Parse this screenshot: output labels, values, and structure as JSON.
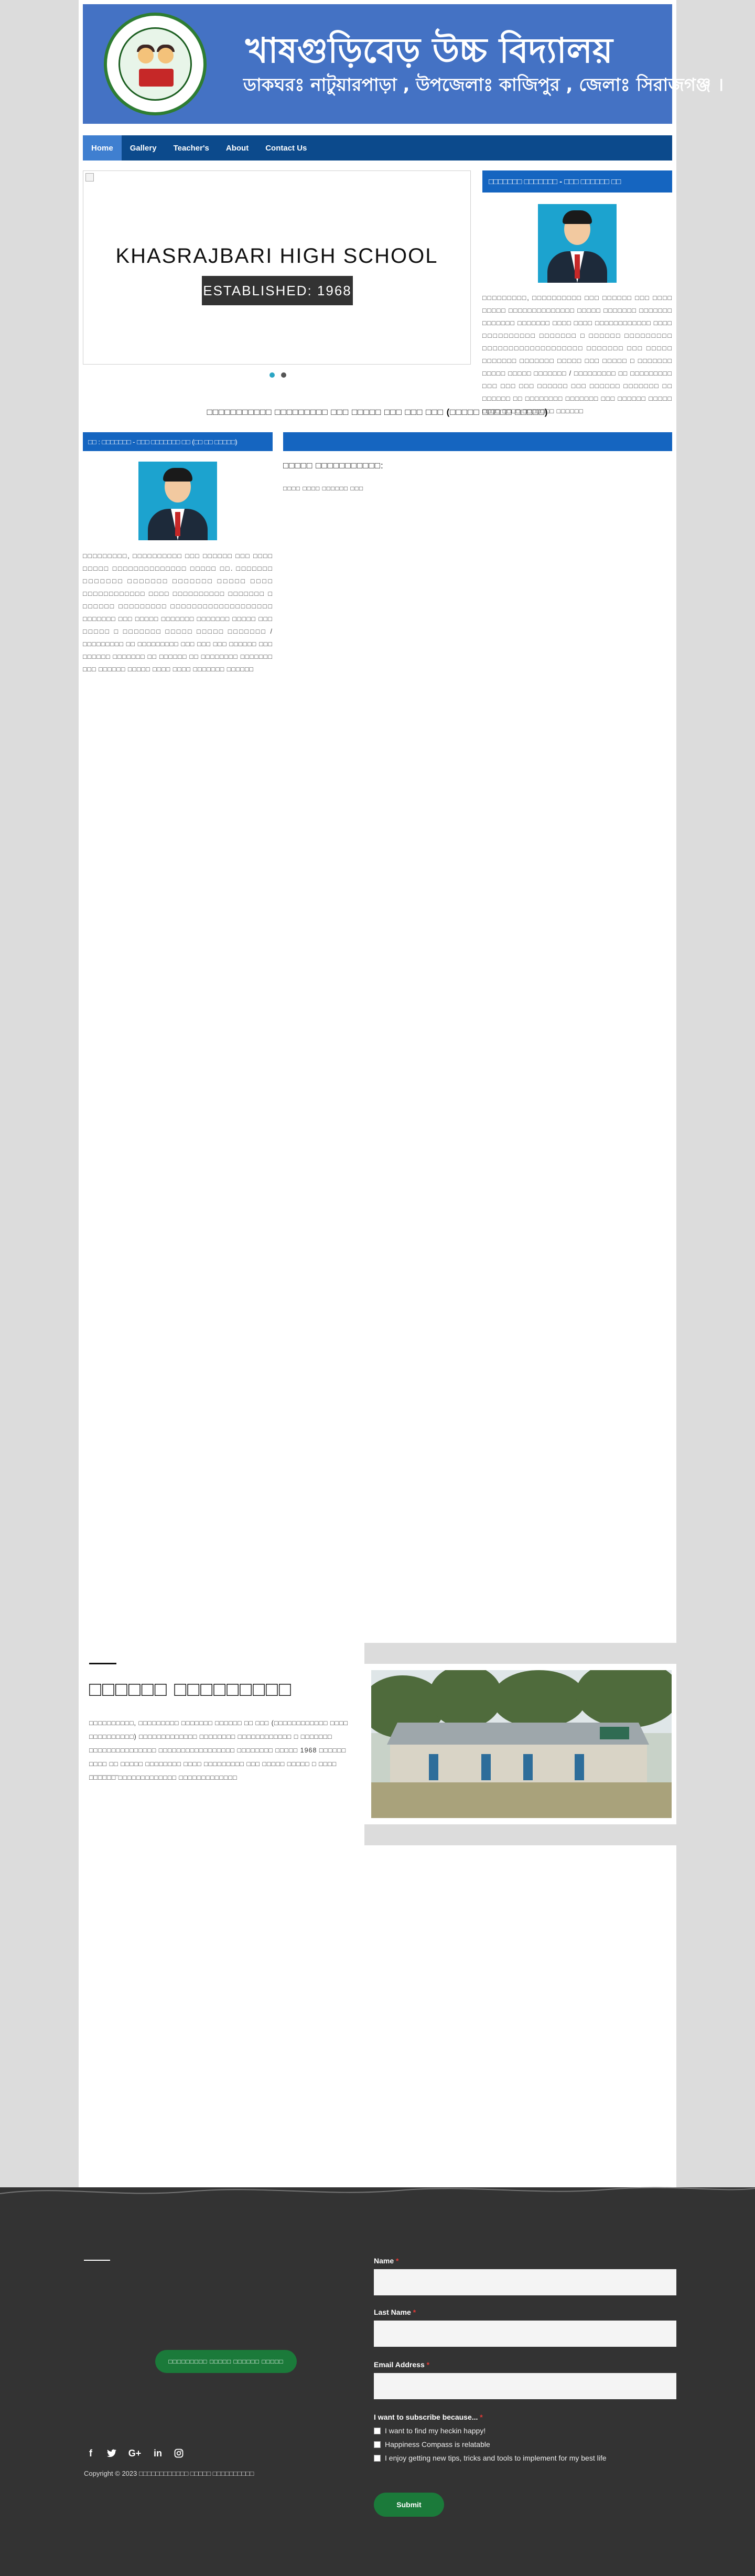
{
  "header": {
    "school_name_bn": "খাষগুড়িবেড় উচ্চ বিদ্যালয়",
    "address_bn": "ডাকঘরঃ নাটুয়ারপাড়া , উপজেলাঃ কাজিপুর , জেলাঃ সিরাজগঞ্জ ।"
  },
  "nav": {
    "items": [
      "Home",
      "Gallery",
      "Teacher's",
      "About",
      "Contact Us"
    ],
    "active": "Home"
  },
  "slider": {
    "title": "KHASRAJBARI HIGH SCHOOL",
    "badge": "ESTABLISHED: 1968",
    "slide_count": 2,
    "active_slide": 1
  },
  "notice": {
    "heading": "□□□□□□□ □□□□□□□ - □□□ □□□□□□ □□",
    "body": "□□□□□□□□□, □□□□□□□□□□ □□□ □□□□□□ □□□ □□□□ □□□□□ □□□□□□□□□□□□□□ □□□□□ □□□□□□□ □□□□□□□ □□□□□□□ □□□□□□□ □□□□ □□□□ □□□□□□□□□□□□ □□□□ □□□□□□□□□□ □□□□□□□ □ □□□□□□ □□□□□□□□□ □□□□□□□□□□□□□□□□□□□ □□□□□□□ □□□ □□□□□ □□□□□□□ □□□□□□□ □□□□□ □□□ □□□□□ □ □□□□□□□ □□□□□ □□□□□ □□□□□□□ / □□□□□□□□□ □□ □□□□□□□□□ □□□ □□□ □□□ □□□□□□ □□□ □□□□□□ □□□□□□□ □□ □□□□□□ □□ □□□□□□□□ □□□□□□□ □□□ □□□□□□ □□□□□ □□□□ □□□□ □□□□□□□ □□□□□□"
  },
  "marquee": "□□□□□□□□□□□ □□□□□□□□□ □□□ □□□□□ □□□ □□□ □□□ (□□□□□ □□□□□ □□□□□)",
  "headmaster": {
    "heading": "□□ : □□□□□□□ - □□□ □□□□□□□ □□ (□□ □□ □□□□□)",
    "body": "□□□□□□□□□, □□□□□□□□□□ □□□ □□□□□□ □□□ □□□□ □□□□□ □□□□□□□□□□□□□□ □□□□□ □□. □□□□□□□ □□□□□□□ □□□□□□□ □□□□□□□ □□□□□ □□□□ □□□□□□□□□□□□ □□□□ □□□□□□□□□□ □□□□□□□ □ □□□□□□ □□□□□□□□□ □□□□□□□□□□□□□□□□□□□ □□□□□□□ □□□ □□□□□ □□□□□□□ □□□□□□□ □□□□□ □□□ □□□□□ □ □□□□□□□ □□□□□ □□□□□ □□□□□□□ / □□□□□□□□□ □□ □□□□□□□□□ □□□ □□□ □□□ □□□□□□ □□□ □□□□□□ □□□□□□□ □□ □□□□□□ □□ □□□□□□□□ □□□□□□□ □□□ □□□□□□ □□□□□ □□□□ □□□□ □□□□□□□ □□□□□□"
  },
  "message": {
    "title": "□□□□□ □□□□□□□□□□□:",
    "subtitle": "□□□□ □□□□ □□□□□□ □□□"
  },
  "about": {
    "title": "□□□□□□ □□□□□□□□□",
    "body": "□□□□□□□□□□, □□□□□□□□□ □□□□□□□ □□□□□□ □□ □□□ (□□□□□□□□□□□□ □□□□ □□□□□□□□□□) □□□□□□□□□□□□□ □□□□□□□□ □□□□□□□□□□□□ □ □□□□□□□ □□□□□□□□□□□□□□□ □□□□□□□□□□□□□□□□□ □□□□□□□□ □□□□□ 1968 □□□□□□ □□□□ □□ □□□□□ □□□□□□□□ □□□□ □□□□□□□□□ □□□ □□□□□ □□□□□ □ □□□□ □□□□□□ □□□□□□□□□□□□□ □□□□□□□□□□□□□"
  },
  "footer": {
    "cta": "□□□□□□□□□ □□□□□ □□□□□□ □□□□□",
    "social": [
      "facebook-icon",
      "twitter-icon",
      "google-plus-icon",
      "linkedin-icon",
      "instagram-icon"
    ],
    "copyright": "Copyright © 2023 □□□□□□□□□□□□ □□□□□ □□□□□□□□□□",
    "form": {
      "name_label": "Name",
      "last_name_label": "Last Name",
      "email_label": "Email Address",
      "required_mark": "*",
      "subscribe_label": "I want to subscribe because...",
      "options": [
        "I want to find my heckin happy!",
        "Happiness Compass is relatable",
        "I enjoy getting new tips, tricks and tools to implement for my best life"
      ],
      "submit_label": "Submit"
    }
  },
  "colors": {
    "banner": "#4472c4",
    "nav": "#0c4a8c",
    "section_heading": "#1565c0",
    "footer": "#333333",
    "cta_green": "#1b7a3a"
  }
}
